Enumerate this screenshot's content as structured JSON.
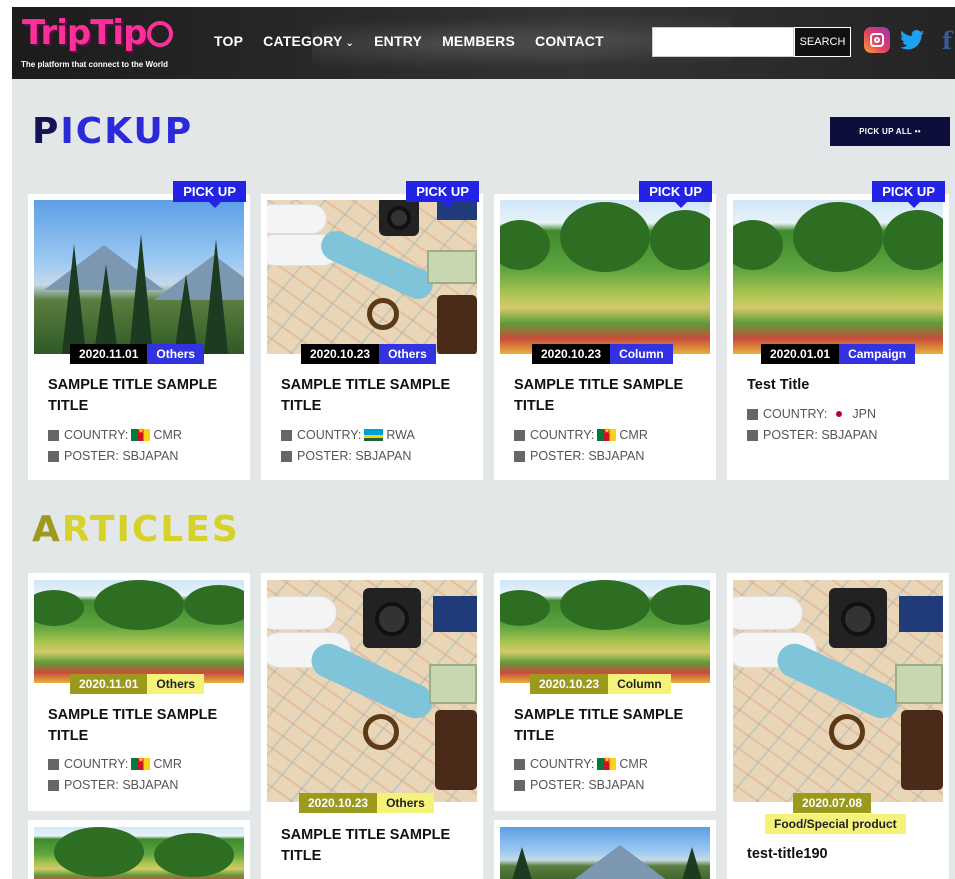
{
  "header": {
    "logo_text": "TripTip",
    "tagline": "The platform that connect to the World",
    "nav": [
      {
        "label": "TOP"
      },
      {
        "label": "CATEGORY",
        "icon": "chevron-down-icon"
      },
      {
        "label": "ENTRY"
      },
      {
        "label": "MEMBERS"
      },
      {
        "label": "CONTACT"
      }
    ],
    "search": {
      "placeholder": "",
      "button_label": "SEARCH"
    },
    "social": [
      "instagram-icon",
      "twitter-icon",
      "facebook-icon"
    ],
    "facebook_glyph": "f"
  },
  "pickup": {
    "title_first": "P",
    "title_rest": "ICKUP",
    "more_label": "PICK UP ALL ••",
    "ribbon_label": "PICK UP",
    "cards": [
      {
        "date": "2020.11.01",
        "category": "Others",
        "title": "SAMPLE TITLE SAMPLE TITLE",
        "country_label": "COUNTRY:",
        "country": "CMR",
        "poster": "POSTER: SBJAPAN"
      },
      {
        "date": "2020.10.23",
        "category": "Others",
        "title": "SAMPLE TITLE SAMPLE TITLE",
        "country_label": "COUNTRY:",
        "country": "RWA",
        "poster": "POSTER: SBJAPAN"
      },
      {
        "date": "2020.10.23",
        "category": "Column",
        "title": "SAMPLE TITLE SAMPLE TITLE",
        "country_label": "COUNTRY:",
        "country": "CMR",
        "poster": "POSTER: SBJAPAN"
      },
      {
        "date": "2020.01.01",
        "category": "Campaign",
        "title": "Test Title",
        "country_label": "COUNTRY:",
        "country": "JPN",
        "poster": "POSTER: SBJAPAN"
      }
    ]
  },
  "articles": {
    "title_first": "A",
    "title_rest": "RTICLES",
    "cards": [
      {
        "date": "2020.11.01",
        "category": "Others",
        "title": "SAMPLE TITLE SAMPLE TITLE",
        "country_label": "COUNTRY:",
        "country": "CMR",
        "poster": "POSTER: SBJAPAN"
      },
      {
        "date": "2020.10.23",
        "category": "Others",
        "title": "SAMPLE TITLE SAMPLE TITLE"
      },
      {
        "date": "2020.10.23",
        "category": "Column",
        "title": "SAMPLE TITLE SAMPLE TITLE",
        "country_label": "COUNTRY:",
        "country": "CMR",
        "poster": "POSTER: SBJAPAN"
      },
      {
        "date": "2020.07.08",
        "category": "Food/Special product",
        "title": "test-title190"
      }
    ]
  },
  "colors": {
    "accent_blue": "#2323e6",
    "accent_olive": "#9c9a1d",
    "accent_yellow": "#f5f27a",
    "header_bg": "#1c1c1c",
    "page_bg": "#e4e7e8"
  }
}
